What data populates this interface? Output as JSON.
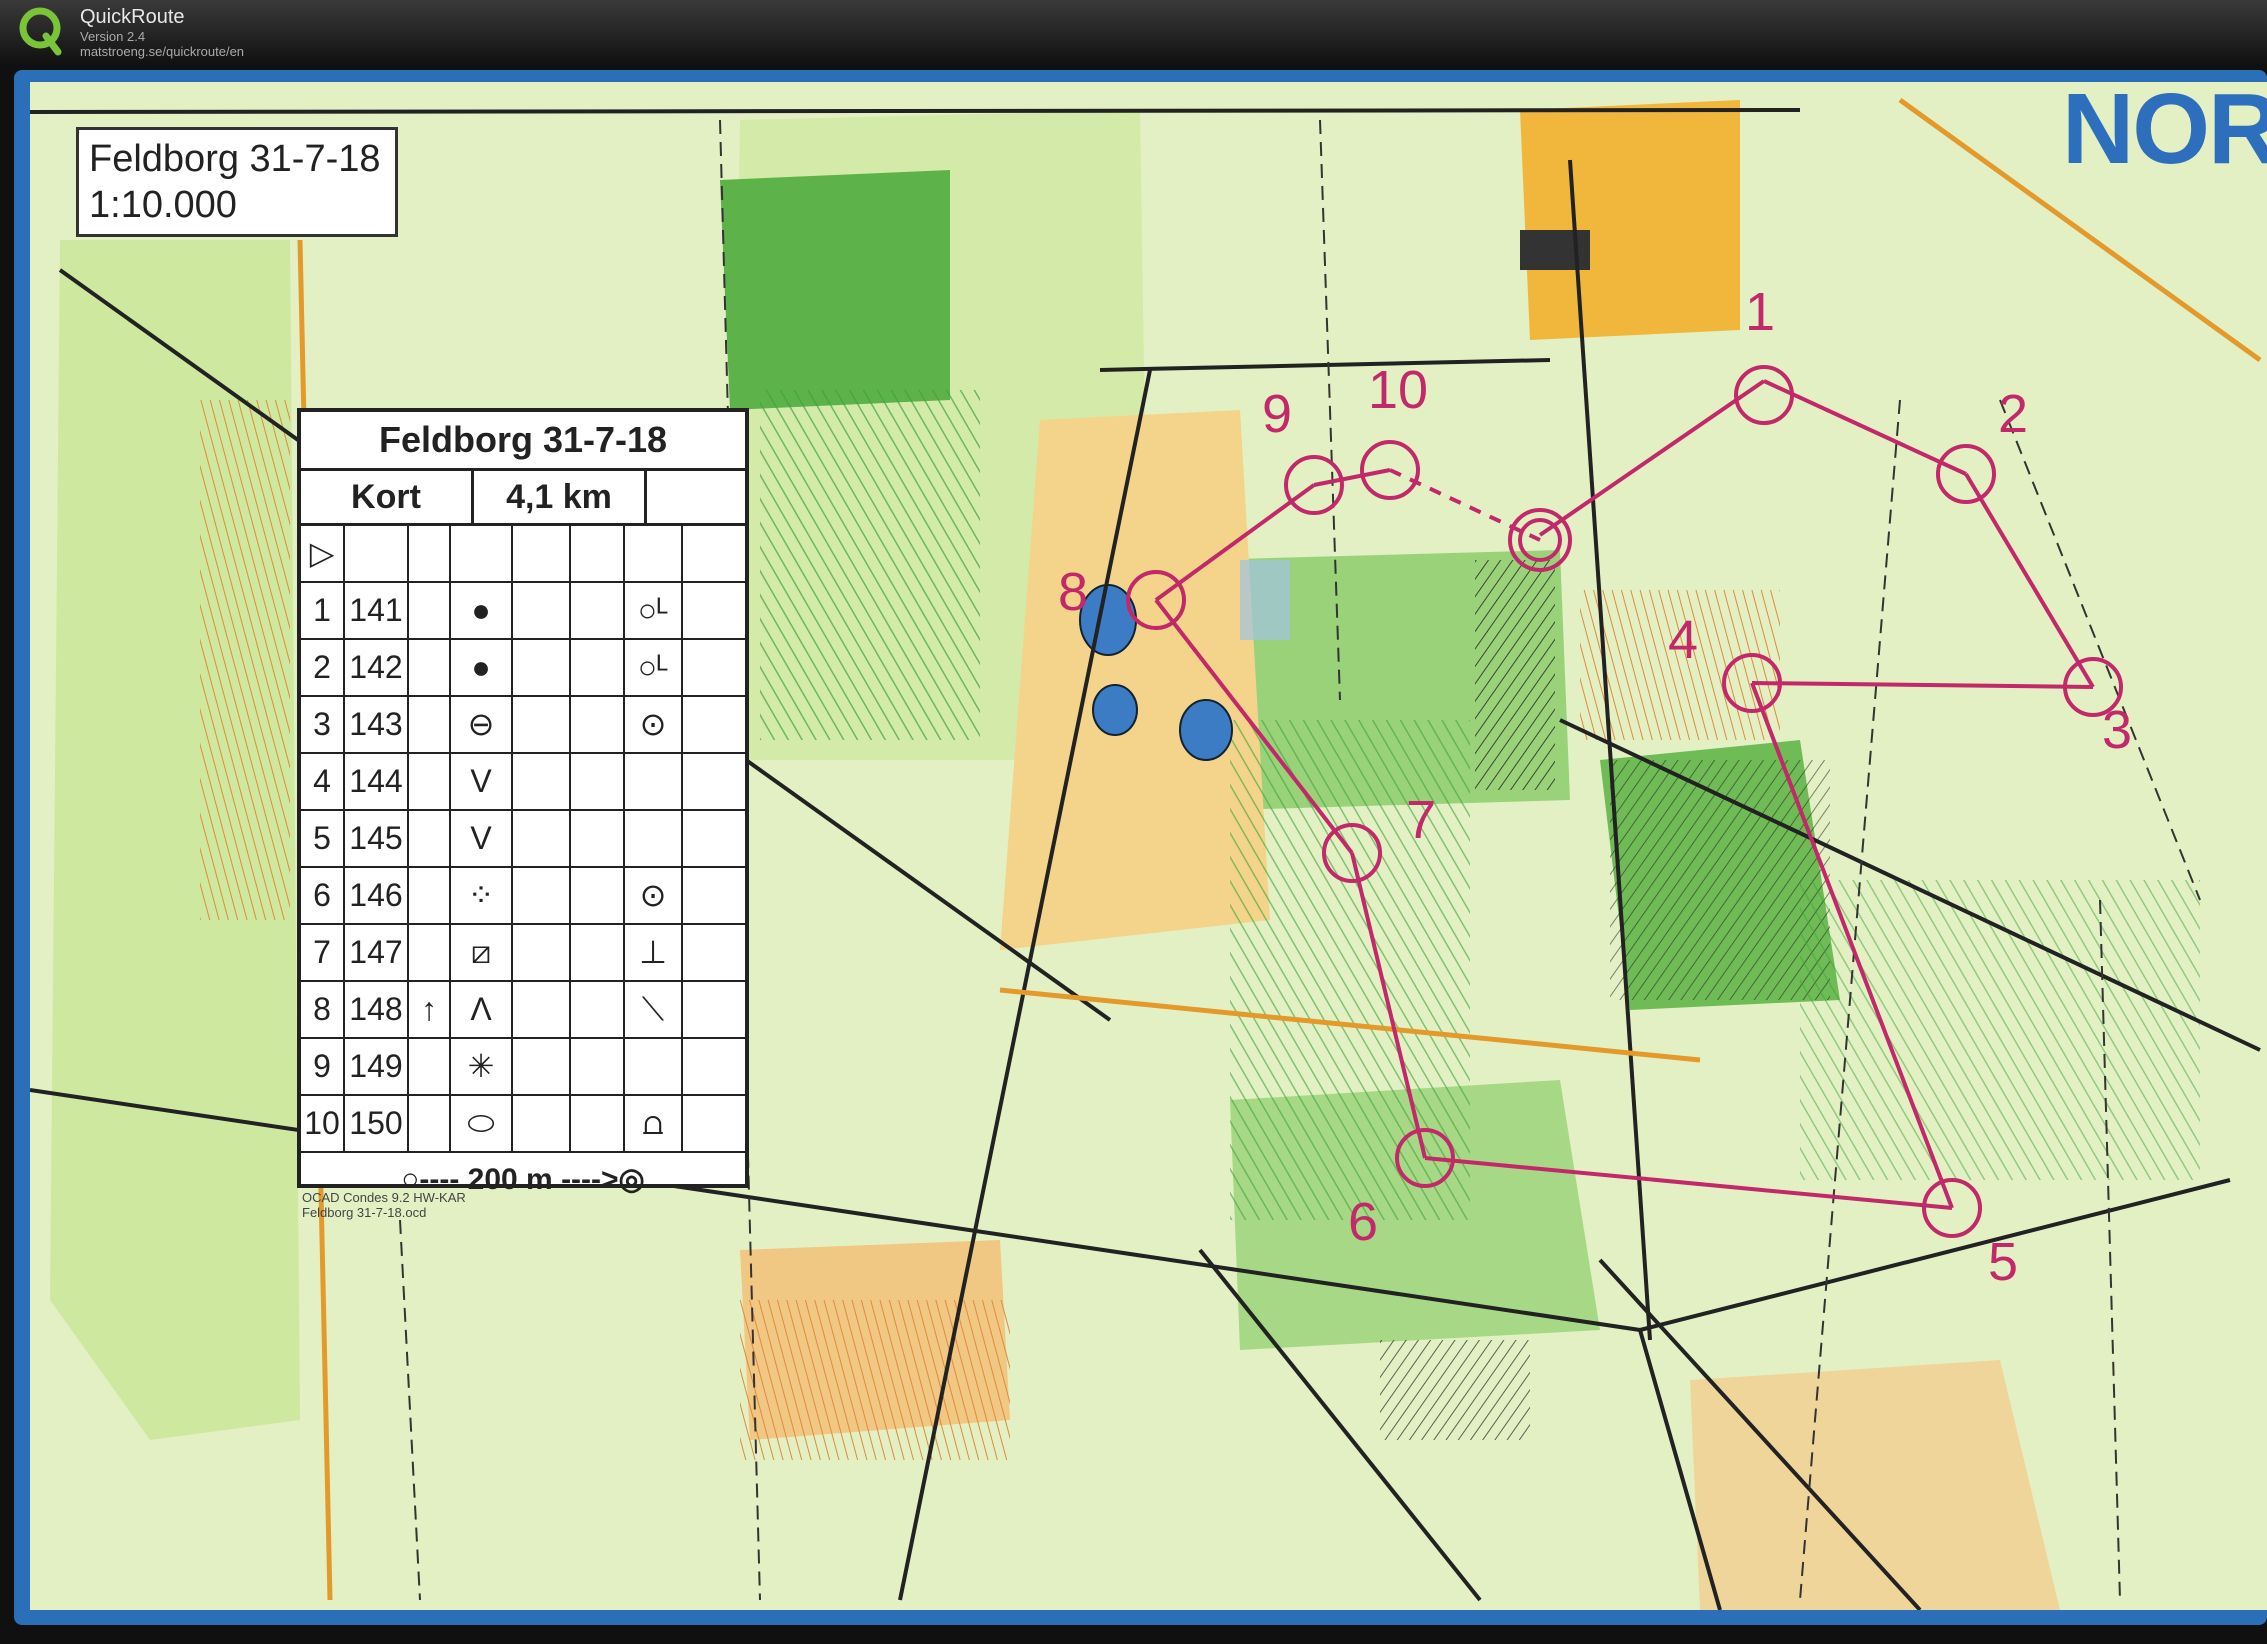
{
  "window": {
    "app_name": "QuickRoute",
    "version": "Version 2.4",
    "url": "matstroeng.se/quickroute/en",
    "logo_letter": "Q",
    "logo_color": "#7ac43a"
  },
  "map": {
    "title": "Feldborg 31-7-18",
    "scale": "1:10.000",
    "print_mark": "NOR",
    "printer_note_1": "OCAD Condes 9.2 HW-KAR",
    "printer_note_2": "Feldborg 31-7-18.ocd",
    "course_color": "#c2286a",
    "colors": {
      "forest": "#d8ecb0",
      "green": "#7ec65a",
      "dark_green": "#3ca43c",
      "open": "#f4d77e",
      "water": "#3c7cc4",
      "blue_border": "#2a6fb8"
    },
    "control_labels": [
      "1",
      "2",
      "3",
      "4",
      "5",
      "6",
      "7",
      "8",
      "9",
      "10"
    ]
  },
  "descriptions": {
    "title": "Feldborg 31-7-18",
    "course": "Kort",
    "length": "4,1 km",
    "start_symbol": "▷",
    "rows": [
      {
        "num": "1",
        "code": "141",
        "dir": "",
        "feature": "●",
        "detail": "○ᴸ"
      },
      {
        "num": "2",
        "code": "142",
        "dir": "",
        "feature": "●",
        "detail": "○ᴸ"
      },
      {
        "num": "3",
        "code": "143",
        "dir": "",
        "feature": "⊖",
        "detail": "⊙"
      },
      {
        "num": "4",
        "code": "144",
        "dir": "",
        "feature": "V",
        "detail": ""
      },
      {
        "num": "5",
        "code": "145",
        "dir": "",
        "feature": "V",
        "detail": ""
      },
      {
        "num": "6",
        "code": "146",
        "dir": "",
        "feature": "⁘",
        "detail": "⊙"
      },
      {
        "num": "7",
        "code": "147",
        "dir": "",
        "feature": "⧄",
        "detail": "⊥"
      },
      {
        "num": "8",
        "code": "148",
        "dir": "↑",
        "feature": "Λ",
        "detail": "⟍"
      },
      {
        "num": "9",
        "code": "149",
        "dir": "",
        "feature": "✳",
        "detail": ""
      },
      {
        "num": "10",
        "code": "150",
        "dir": "",
        "feature": "⬭",
        "detail": "⩍"
      }
    ],
    "finish": "○---- 200 m ---->◎"
  }
}
